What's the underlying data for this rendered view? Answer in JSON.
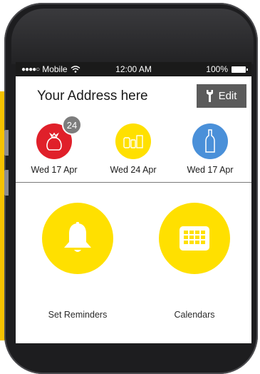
{
  "status_bar": {
    "carrier": "Mobile",
    "time": "12:00 AM",
    "battery": "100%",
    "signal_dots": "●●●●○"
  },
  "header": {
    "address": "Your Address here",
    "edit_label": "Edit"
  },
  "bins": [
    {
      "date": "Wed 17 Apr",
      "color": "#e0202a",
      "icon": "garbage-bag-icon",
      "badge": "24"
    },
    {
      "date": "Wed 24 Apr",
      "color": "#ffe000",
      "icon": "recycling-containers-icon"
    },
    {
      "date": "Wed 17 Apr",
      "color": "#4a90d9",
      "icon": "bottle-icon"
    }
  ],
  "actions": {
    "reminders_label": "Set Reminders",
    "calendars_label": "Calendars"
  },
  "colors": {
    "accent_yellow": "#ffe000",
    "edit_button": "#5b5b5b",
    "badge": "#7d7d7d"
  }
}
